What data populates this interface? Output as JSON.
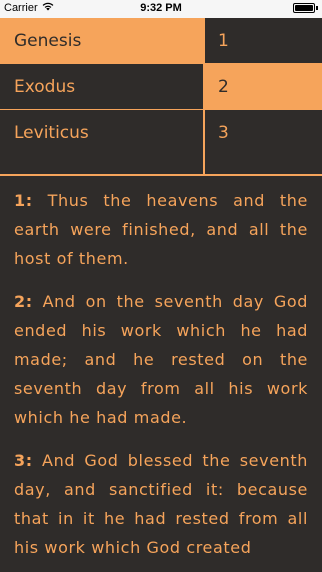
{
  "status_bar": {
    "carrier": "Carrier",
    "time": "9:32 PM",
    "icons": [
      "wifi-icon",
      "battery-icon"
    ],
    "battery_level": 1.0
  },
  "books": [
    {
      "label": "Genesis",
      "selected": true
    },
    {
      "label": "Exodus",
      "selected": false
    },
    {
      "label": "Leviticus",
      "selected": false
    }
  ],
  "chapters": [
    {
      "label": "1",
      "selected": false
    },
    {
      "label": "2",
      "selected": true
    },
    {
      "label": "3",
      "selected": false
    }
  ],
  "verses": [
    {
      "number": "1:",
      "text": "Thus the heavens and the earth were finished, and all the host of them."
    },
    {
      "number": "2:",
      "text": "And on the seventh day God ended his work which he had made; and he rested on the seventh day from all his work which he had made."
    },
    {
      "number": "3:",
      "text": "And God blessed the seventh day, and sanctified it: because that in it he had rested from all his work which God created"
    }
  ],
  "colors": {
    "accent": "#f6a45b",
    "background": "#2f2c2a",
    "status_bar": "#f6f6f6"
  }
}
